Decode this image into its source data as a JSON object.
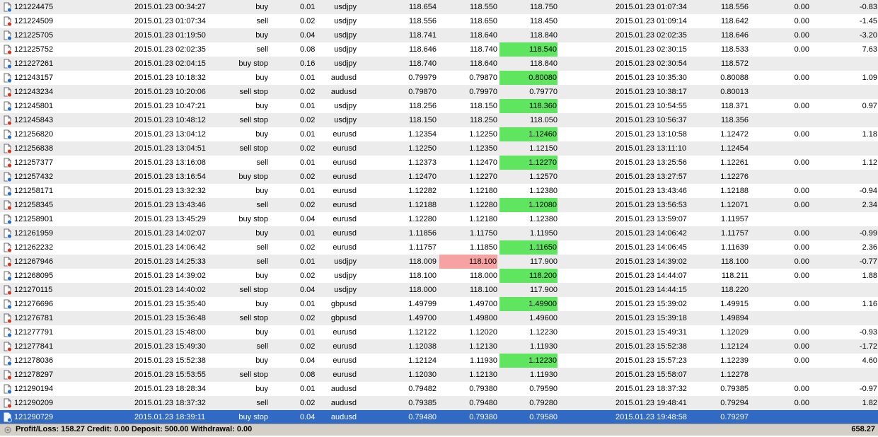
{
  "rows": [
    {
      "ticket": "121224475",
      "open_time": "2015.01.23 00:34:27",
      "type": "buy",
      "size": "0.01",
      "symbol": "usdjpy",
      "price": "118.654",
      "sl": "118.550",
      "tp": "118.750",
      "close_time": "2015.01.23 01:07:34",
      "close_price": "118.556",
      "swap": "0.00",
      "profit": "-0.83",
      "sl_hl": "",
      "tp_hl": "",
      "icon": "buy-order-icon"
    },
    {
      "ticket": "121224509",
      "open_time": "2015.01.23 01:07:34",
      "type": "sell",
      "size": "0.02",
      "symbol": "usdjpy",
      "price": "118.556",
      "sl": "118.650",
      "tp": "118.450",
      "close_time": "2015.01.23 01:09:14",
      "close_price": "118.642",
      "swap": "0.00",
      "profit": "-1.45",
      "sl_hl": "",
      "tp_hl": "",
      "icon": "sell-order-icon"
    },
    {
      "ticket": "121225705",
      "open_time": "2015.01.23 01:19:50",
      "type": "buy",
      "size": "0.04",
      "symbol": "usdjpy",
      "price": "118.741",
      "sl": "118.640",
      "tp": "118.840",
      "close_time": "2015.01.23 02:02:35",
      "close_price": "118.646",
      "swap": "0.00",
      "profit": "-3.20",
      "sl_hl": "",
      "tp_hl": "",
      "icon": "buy-order-icon"
    },
    {
      "ticket": "121225752",
      "open_time": "2015.01.23 02:02:35",
      "type": "sell",
      "size": "0.08",
      "symbol": "usdjpy",
      "price": "118.646",
      "sl": "118.740",
      "tp": "118.540",
      "close_time": "2015.01.23 02:30:15",
      "close_price": "118.533",
      "swap": "0.00",
      "profit": "7.63",
      "sl_hl": "",
      "tp_hl": "green",
      "icon": "sell-order-icon"
    },
    {
      "ticket": "121227261",
      "open_time": "2015.01.23 02:04:15",
      "type": "buy stop",
      "size": "0.16",
      "symbol": "usdjpy",
      "price": "118.740",
      "sl": "118.640",
      "tp": "118.840",
      "close_time": "2015.01.23 02:30:54",
      "close_price": "118.572",
      "swap": "",
      "profit": "",
      "sl_hl": "",
      "tp_hl": "",
      "icon": "buy-order-icon"
    },
    {
      "ticket": "121243157",
      "open_time": "2015.01.23 10:18:32",
      "type": "buy",
      "size": "0.01",
      "symbol": "audusd",
      "price": "0.79979",
      "sl": "0.79870",
      "tp": "0.80080",
      "close_time": "2015.01.23 10:35:30",
      "close_price": "0.80088",
      "swap": "0.00",
      "profit": "1.09",
      "sl_hl": "",
      "tp_hl": "green",
      "icon": "buy-order-icon"
    },
    {
      "ticket": "121243234",
      "open_time": "2015.01.23 10:20:06",
      "type": "sell stop",
      "size": "0.02",
      "symbol": "audusd",
      "price": "0.79870",
      "sl": "0.79970",
      "tp": "0.79770",
      "close_time": "2015.01.23 10:38:17",
      "close_price": "0.80013",
      "swap": "",
      "profit": "",
      "sl_hl": "",
      "tp_hl": "",
      "icon": "sell-order-icon"
    },
    {
      "ticket": "121245801",
      "open_time": "2015.01.23 10:47:21",
      "type": "buy",
      "size": "0.01",
      "symbol": "usdjpy",
      "price": "118.256",
      "sl": "118.150",
      "tp": "118.360",
      "close_time": "2015.01.23 10:54:55",
      "close_price": "118.371",
      "swap": "0.00",
      "profit": "0.97",
      "sl_hl": "",
      "tp_hl": "green",
      "icon": "buy-order-icon"
    },
    {
      "ticket": "121245843",
      "open_time": "2015.01.23 10:48:12",
      "type": "sell stop",
      "size": "0.02",
      "symbol": "usdjpy",
      "price": "118.150",
      "sl": "118.250",
      "tp": "118.050",
      "close_time": "2015.01.23 10:56:37",
      "close_price": "118.356",
      "swap": "",
      "profit": "",
      "sl_hl": "",
      "tp_hl": "",
      "icon": "sell-order-icon"
    },
    {
      "ticket": "121256820",
      "open_time": "2015.01.23 13:04:12",
      "type": "buy",
      "size": "0.01",
      "symbol": "eurusd",
      "price": "1.12354",
      "sl": "1.12250",
      "tp": "1.12460",
      "close_time": "2015.01.23 13:10:58",
      "close_price": "1.12472",
      "swap": "0.00",
      "profit": "1.18",
      "sl_hl": "",
      "tp_hl": "green",
      "icon": "buy-order-icon"
    },
    {
      "ticket": "121256838",
      "open_time": "2015.01.23 13:04:51",
      "type": "sell stop",
      "size": "0.02",
      "symbol": "eurusd",
      "price": "1.12250",
      "sl": "1.12350",
      "tp": "1.12150",
      "close_time": "2015.01.23 13:11:10",
      "close_price": "1.12454",
      "swap": "",
      "profit": "",
      "sl_hl": "",
      "tp_hl": "",
      "icon": "sell-order-icon"
    },
    {
      "ticket": "121257377",
      "open_time": "2015.01.23 13:16:08",
      "type": "sell",
      "size": "0.01",
      "symbol": "eurusd",
      "price": "1.12373",
      "sl": "1.12470",
      "tp": "1.12270",
      "close_time": "2015.01.23 13:25:56",
      "close_price": "1.12261",
      "swap": "0.00",
      "profit": "1.12",
      "sl_hl": "",
      "tp_hl": "green",
      "icon": "sell-order-icon"
    },
    {
      "ticket": "121257432",
      "open_time": "2015.01.23 13:16:54",
      "type": "buy stop",
      "size": "0.02",
      "symbol": "eurusd",
      "price": "1.12470",
      "sl": "1.12270",
      "tp": "1.12570",
      "close_time": "2015.01.23 13:27:57",
      "close_price": "1.12276",
      "swap": "",
      "profit": "",
      "sl_hl": "",
      "tp_hl": "",
      "icon": "buy-order-icon"
    },
    {
      "ticket": "121258171",
      "open_time": "2015.01.23 13:32:32",
      "type": "buy",
      "size": "0.01",
      "symbol": "eurusd",
      "price": "1.12282",
      "sl": "1.12180",
      "tp": "1.12380",
      "close_time": "2015.01.23 13:43:46",
      "close_price": "1.12188",
      "swap": "0.00",
      "profit": "-0.94",
      "sl_hl": "",
      "tp_hl": "",
      "icon": "buy-order-icon"
    },
    {
      "ticket": "121258345",
      "open_time": "2015.01.23 13:43:46",
      "type": "sell",
      "size": "0.02",
      "symbol": "eurusd",
      "price": "1.12188",
      "sl": "1.12280",
      "tp": "1.12080",
      "close_time": "2015.01.23 13:56:53",
      "close_price": "1.12071",
      "swap": "0.00",
      "profit": "2.34",
      "sl_hl": "",
      "tp_hl": "green",
      "icon": "sell-order-icon"
    },
    {
      "ticket": "121258901",
      "open_time": "2015.01.23 13:45:29",
      "type": "buy stop",
      "size": "0.04",
      "symbol": "eurusd",
      "price": "1.12280",
      "sl": "1.12180",
      "tp": "1.12380",
      "close_time": "2015.01.23 13:59:07",
      "close_price": "1.11957",
      "swap": "",
      "profit": "",
      "sl_hl": "",
      "tp_hl": "",
      "icon": "buy-order-icon"
    },
    {
      "ticket": "121261959",
      "open_time": "2015.01.23 14:02:07",
      "type": "buy",
      "size": "0.01",
      "symbol": "eurusd",
      "price": "1.11856",
      "sl": "1.11750",
      "tp": "1.11950",
      "close_time": "2015.01.23 14:06:42",
      "close_price": "1.11757",
      "swap": "0.00",
      "profit": "-0.99",
      "sl_hl": "",
      "tp_hl": "",
      "icon": "buy-order-icon"
    },
    {
      "ticket": "121262232",
      "open_time": "2015.01.23 14:06:42",
      "type": "sell",
      "size": "0.02",
      "symbol": "eurusd",
      "price": "1.11757",
      "sl": "1.11850",
      "tp": "1.11650",
      "close_time": "2015.01.23 14:06:45",
      "close_price": "1.11639",
      "swap": "0.00",
      "profit": "2.36",
      "sl_hl": "",
      "tp_hl": "green",
      "icon": "sell-order-icon"
    },
    {
      "ticket": "121267946",
      "open_time": "2015.01.23 14:25:33",
      "type": "sell",
      "size": "0.01",
      "symbol": "usdjpy",
      "price": "118.009",
      "sl": "118.100",
      "tp": "117.900",
      "close_time": "2015.01.23 14:39:02",
      "close_price": "118.100",
      "swap": "0.00",
      "profit": "-0.77",
      "sl_hl": "red",
      "tp_hl": "",
      "icon": "sell-order-icon"
    },
    {
      "ticket": "121268095",
      "open_time": "2015.01.23 14:39:02",
      "type": "buy",
      "size": "0.02",
      "symbol": "usdjpy",
      "price": "118.100",
      "sl": "118.000",
      "tp": "118.200",
      "close_time": "2015.01.23 14:44:07",
      "close_price": "118.211",
      "swap": "0.00",
      "profit": "1.88",
      "sl_hl": "",
      "tp_hl": "green",
      "icon": "buy-order-icon"
    },
    {
      "ticket": "121270115",
      "open_time": "2015.01.23 14:40:02",
      "type": "sell stop",
      "size": "0.04",
      "symbol": "usdjpy",
      "price": "118.000",
      "sl": "118.100",
      "tp": "117.900",
      "close_time": "2015.01.23 14:44:15",
      "close_price": "118.220",
      "swap": "",
      "profit": "",
      "sl_hl": "",
      "tp_hl": "",
      "icon": "sell-order-icon"
    },
    {
      "ticket": "121276696",
      "open_time": "2015.01.23 15:35:40",
      "type": "buy",
      "size": "0.01",
      "symbol": "gbpusd",
      "price": "1.49799",
      "sl": "1.49700",
      "tp": "1.49900",
      "close_time": "2015.01.23 15:39:02",
      "close_price": "1.49915",
      "swap": "0.00",
      "profit": "1.16",
      "sl_hl": "",
      "tp_hl": "green",
      "icon": "buy-order-icon"
    },
    {
      "ticket": "121276781",
      "open_time": "2015.01.23 15:36:48",
      "type": "sell stop",
      "size": "0.02",
      "symbol": "gbpusd",
      "price": "1.49700",
      "sl": "1.49800",
      "tp": "1.49600",
      "close_time": "2015.01.23 15:39:18",
      "close_price": "1.49894",
      "swap": "",
      "profit": "",
      "sl_hl": "",
      "tp_hl": "",
      "icon": "sell-order-icon"
    },
    {
      "ticket": "121277791",
      "open_time": "2015.01.23 15:48:00",
      "type": "buy",
      "size": "0.01",
      "symbol": "eurusd",
      "price": "1.12122",
      "sl": "1.12020",
      "tp": "1.12230",
      "close_time": "2015.01.23 15:49:31",
      "close_price": "1.12029",
      "swap": "0.00",
      "profit": "-0.93",
      "sl_hl": "",
      "tp_hl": "",
      "icon": "buy-order-icon"
    },
    {
      "ticket": "121277841",
      "open_time": "2015.01.23 15:49:30",
      "type": "sell",
      "size": "0.02",
      "symbol": "eurusd",
      "price": "1.12038",
      "sl": "1.12130",
      "tp": "1.11930",
      "close_time": "2015.01.23 15:52:38",
      "close_price": "1.12124",
      "swap": "0.00",
      "profit": "-1.72",
      "sl_hl": "",
      "tp_hl": "",
      "icon": "sell-order-icon"
    },
    {
      "ticket": "121278036",
      "open_time": "2015.01.23 15:52:38",
      "type": "buy",
      "size": "0.04",
      "symbol": "eurusd",
      "price": "1.12124",
      "sl": "1.11930",
      "tp": "1.12230",
      "close_time": "2015.01.23 15:57:23",
      "close_price": "1.12239",
      "swap": "0.00",
      "profit": "4.60",
      "sl_hl": "",
      "tp_hl": "green",
      "icon": "buy-order-icon"
    },
    {
      "ticket": "121278297",
      "open_time": "2015.01.23 15:53:55",
      "type": "sell stop",
      "size": "0.08",
      "symbol": "eurusd",
      "price": "1.12030",
      "sl": "1.12130",
      "tp": "1.11930",
      "close_time": "2015.01.23 15:58:07",
      "close_price": "1.12278",
      "swap": "",
      "profit": "",
      "sl_hl": "",
      "tp_hl": "",
      "icon": "sell-order-icon"
    },
    {
      "ticket": "121290194",
      "open_time": "2015.01.23 18:28:34",
      "type": "buy",
      "size": "0.01",
      "symbol": "audusd",
      "price": "0.79482",
      "sl": "0.79380",
      "tp": "0.79590",
      "close_time": "2015.01.23 18:37:32",
      "close_price": "0.79385",
      "swap": "0.00",
      "profit": "-0.97",
      "sl_hl": "",
      "tp_hl": "",
      "icon": "buy-order-icon"
    },
    {
      "ticket": "121290209",
      "open_time": "2015.01.23 18:37:32",
      "type": "sell",
      "size": "0.02",
      "symbol": "audusd",
      "price": "0.79385",
      "sl": "0.79480",
      "tp": "0.79280",
      "close_time": "2015.01.23 19:48:41",
      "close_price": "0.79294",
      "swap": "0.00",
      "profit": "1.82",
      "sl_hl": "",
      "tp_hl": "",
      "icon": "sell-order-icon"
    },
    {
      "ticket": "121290729",
      "open_time": "2015.01.23 18:39:11",
      "type": "buy stop",
      "size": "0.04",
      "symbol": "audusd",
      "price": "0.79480",
      "sl": "0.79380",
      "tp": "0.79580",
      "close_time": "2015.01.23 19:48:58",
      "close_price": "0.79297",
      "swap": "",
      "profit": "",
      "sl_hl": "",
      "tp_hl": "",
      "icon": "buy-order-icon",
      "selected": true
    }
  ],
  "status": {
    "summary": "Profit/Loss: 158.27  Credit: 0.00  Deposit: 500.00  Withdrawal: 0.00",
    "total": "658.27",
    "icon": "summary-icon"
  },
  "colors": {
    "buy_badge": "#1f6fd1",
    "sell_badge": "#d8341c",
    "tp_hit": "#5fe55f",
    "sl_hit": "#f6a2a2",
    "selected_row": "#316ac5",
    "alt_row": "#ececec",
    "status_bar": "#d4d0c8"
  }
}
